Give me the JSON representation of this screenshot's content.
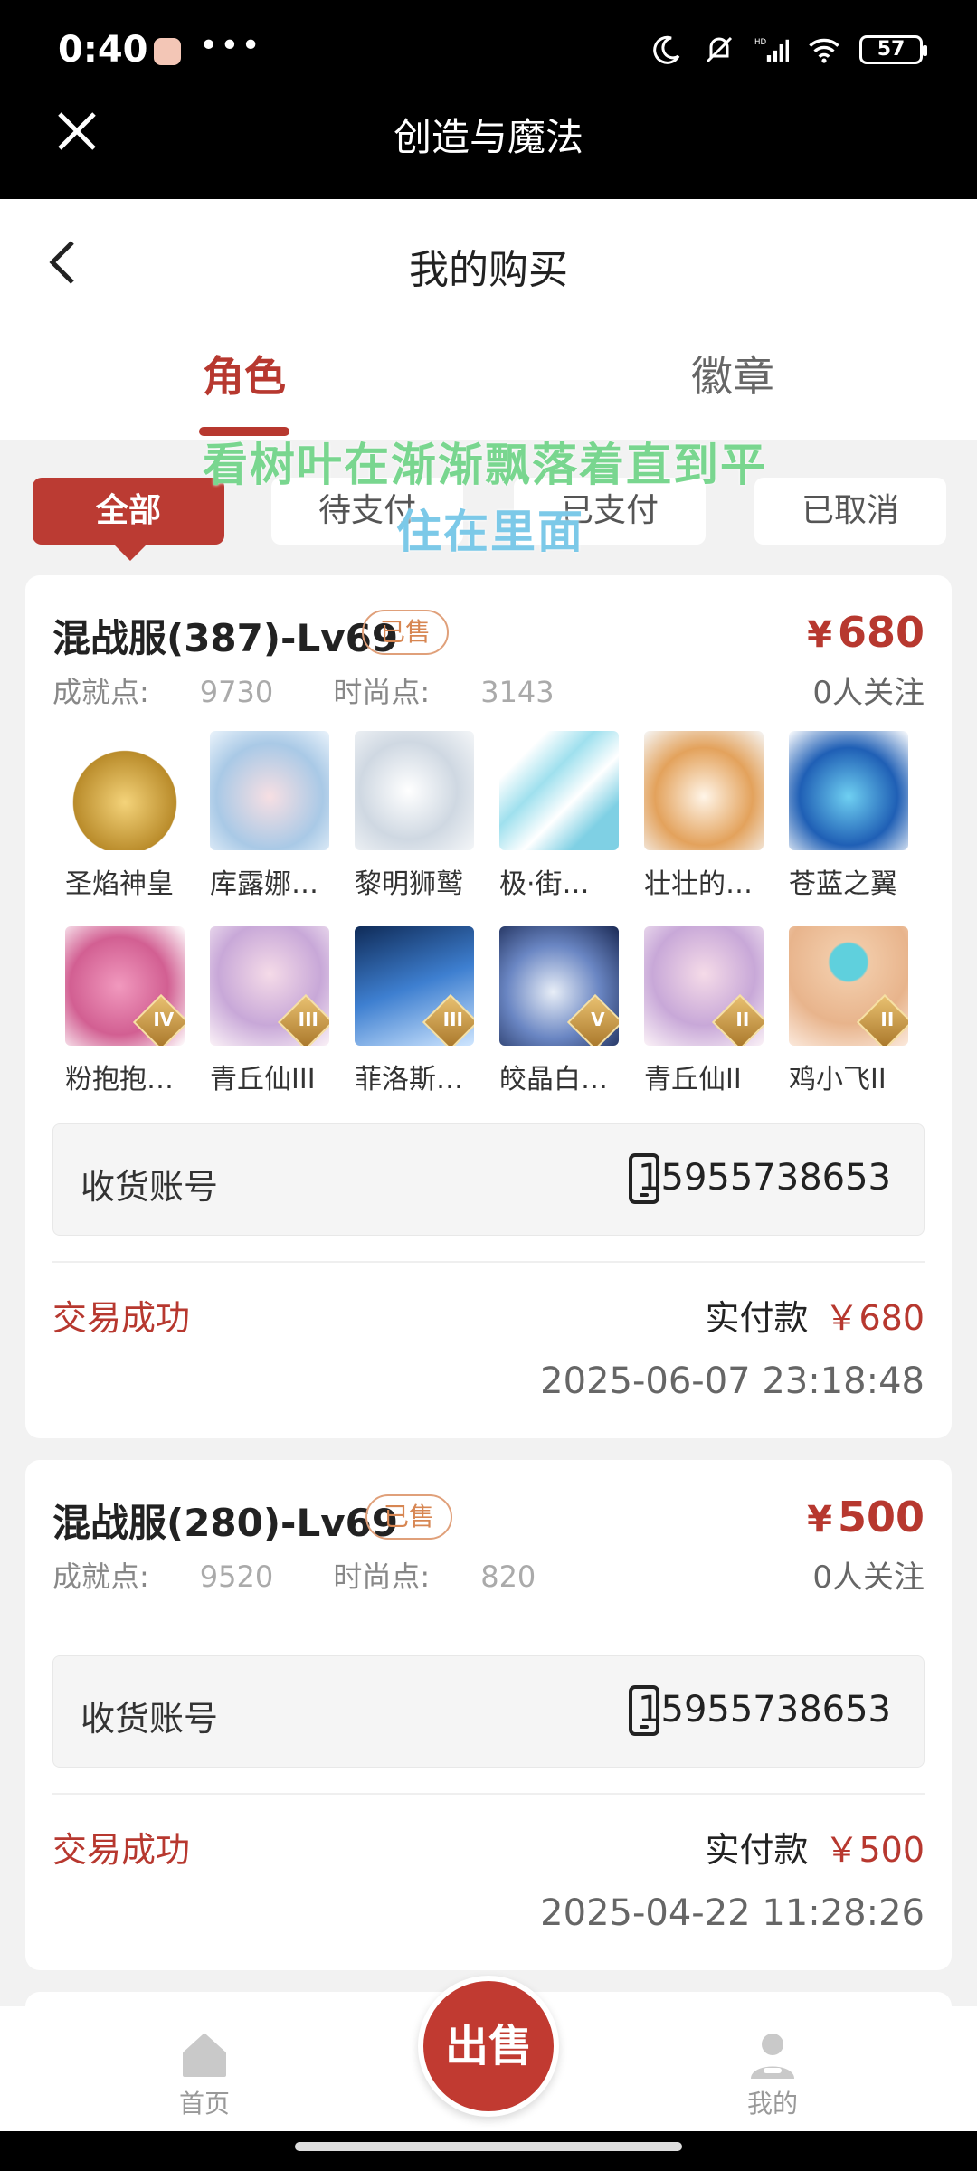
{
  "status_bar": {
    "time": "0:40",
    "dots": "•••",
    "battery": "57"
  },
  "app": {
    "title": "创造与魔法"
  },
  "page": {
    "title": "我的购买"
  },
  "tabs": [
    {
      "label": "角色"
    },
    {
      "label": "徽章"
    }
  ],
  "filters": [
    {
      "label": "全部"
    },
    {
      "label": "待支付"
    },
    {
      "label": "已支付"
    },
    {
      "label": "已取消"
    }
  ],
  "overlay": {
    "line1": "看树叶在渐渐飘落着直到平",
    "line2": "住在里面"
  },
  "orders": [
    {
      "title": "混战服(387)-Lv69",
      "badge": "已售",
      "yen": "¥",
      "price": "680",
      "achievement_label": "成就点:",
      "achievement": "9730",
      "fashion_label": "时尚点:",
      "fashion": "3143",
      "followers": "0人关注",
      "items": [
        {
          "name": "圣焰神皇"
        },
        {
          "name": "库露娜…"
        },
        {
          "name": "黎明狮鹫"
        },
        {
          "name": "极·街…"
        },
        {
          "name": "壮壮的…"
        },
        {
          "name": "苍蓝之翼"
        },
        {
          "name": "粉抱抱…",
          "tier": "IV"
        },
        {
          "name": "青丘仙III",
          "tier": "III"
        },
        {
          "name": "菲洛斯…",
          "tier": "III"
        },
        {
          "name": "皎晶白…",
          "tier": "V"
        },
        {
          "name": "青丘仙II",
          "tier": "II"
        },
        {
          "name": "鸡小飞II",
          "tier": "II"
        }
      ],
      "account_label": "收货账号",
      "account": "15955738653",
      "status": "交易成功",
      "paid_label": "实付款",
      "paid_amount": "￥680",
      "date": "2025-06-07 23:18:48"
    },
    {
      "title": "混战服(280)-Lv69",
      "badge": "已售",
      "yen": "¥",
      "price": "500",
      "achievement_label": "成就点:",
      "achievement": "9520",
      "fashion_label": "时尚点:",
      "fashion": "820",
      "followers": "0人关注",
      "account_label": "收货账号",
      "account": "15955738653",
      "status": "交易成功",
      "paid_label": "实付款",
      "paid_amount": "￥500",
      "date": "2025-04-22 11:28:26"
    }
  ],
  "bottom_nav": {
    "home": "首页",
    "sell": "出售",
    "mine": "我的"
  },
  "colors": {
    "accent": "#b7382f",
    "badge": "#d78652",
    "header_bg": "#000000"
  }
}
